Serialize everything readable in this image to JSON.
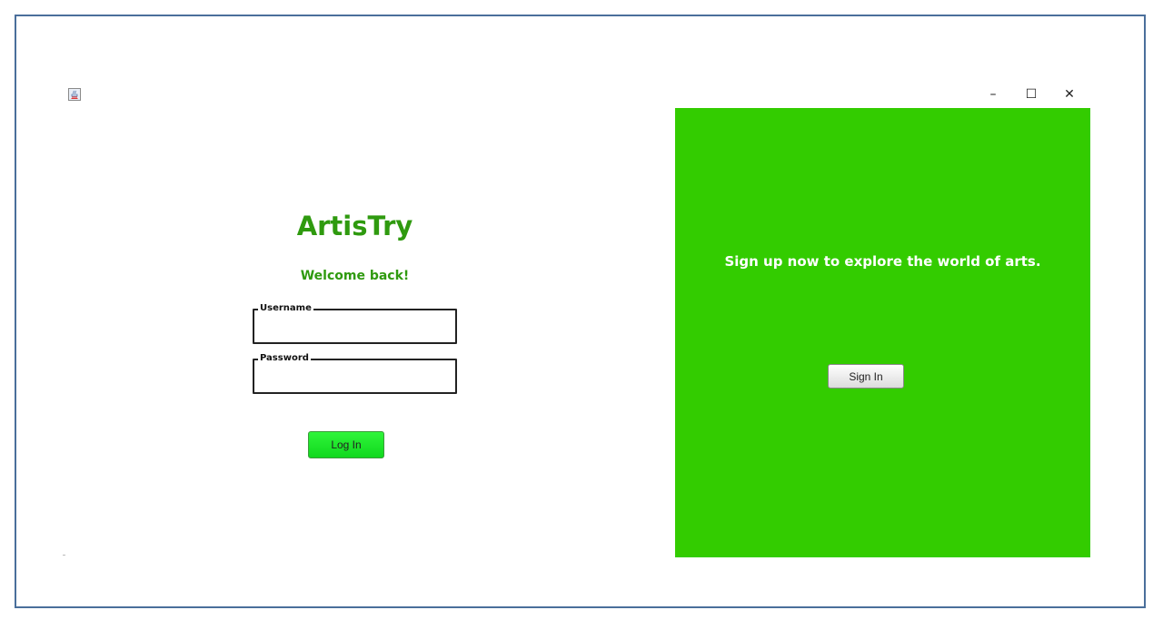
{
  "app": {
    "icon": "java-icon",
    "brand_color": "#2f9a0f",
    "panel_color": "#33cc00"
  },
  "window_controls": {
    "minimize": "–",
    "maximize": "☐",
    "close": "✕"
  },
  "login": {
    "title": "ArtisTry",
    "subtitle": "Welcome back!",
    "username_label": "Username",
    "username_value": "",
    "password_label": "Password",
    "password_value": "",
    "login_button": "Log In"
  },
  "signup_panel": {
    "message": "Sign up now to explore the world of arts.",
    "signin_button": "Sign In"
  }
}
